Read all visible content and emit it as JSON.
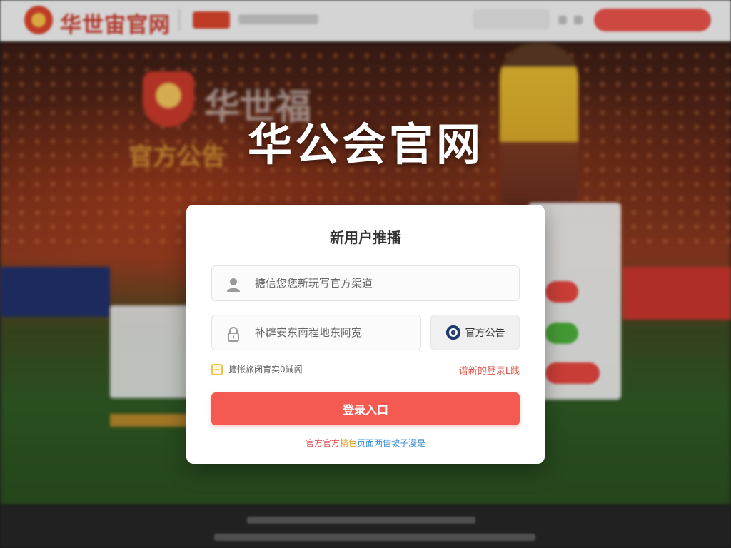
{
  "background": {
    "site_logo_text": "华世宙官网",
    "hero_title": "华世福",
    "hero_subtitle": "官方公告"
  },
  "hero": {
    "title": "华公会官网"
  },
  "login_card": {
    "title": "新用户推播",
    "username": {
      "placeholder": "搪信您您新玩写官方渠道",
      "value": ""
    },
    "password": {
      "placeholder": "补辟安东南程地东阿宽",
      "value": ""
    },
    "notice_button": {
      "label": "官方公告",
      "icon": "target-icon"
    },
    "remember": {
      "label": "搪怅旅闭育实0诫阁",
      "checked": false
    },
    "latest_link": "谱新的登录L践",
    "submit_label": "登录入口",
    "footer_tip": {
      "part1": "官方官方",
      "part2": "精色",
      "part3": "页面两信坡子漫是"
    }
  },
  "colors": {
    "accent": "#f45a51",
    "link": "#e05a4f",
    "checkbox": "#f0c24a",
    "card_bg": "#ffffff",
    "notice_icon": "#1f3a6e"
  }
}
